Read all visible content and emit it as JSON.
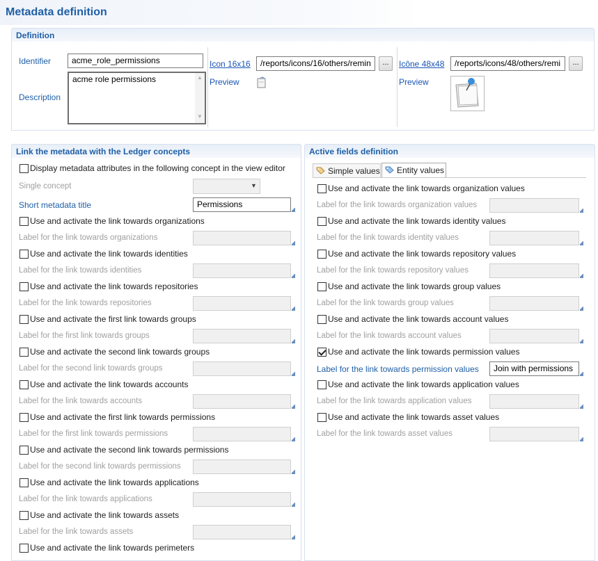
{
  "page": {
    "title": "Metadata definition"
  },
  "definition": {
    "header": "Definition",
    "identifier_label": "Identifier",
    "identifier_value": "acme_role_permissions",
    "description_label": "Description",
    "description_value": "acme role permissions",
    "icon16": {
      "label": "Icon 16x16",
      "path": "/reports/icons/16/others/remin",
      "browse": "...",
      "preview_label": "Preview",
      "preview_icon": "note-icon"
    },
    "icon48": {
      "label": "Icône 48x48",
      "path": "/reports/icons/48/others/remi",
      "browse": "...",
      "preview_label": "Preview",
      "preview_icon": "pinned-note-icon"
    }
  },
  "ledger": {
    "header": "Link the metadata with the Ledger concepts",
    "display_checkbox": "Display metadata attributes in the following concept in the view editor",
    "single_concept_label": "Single concept",
    "short_title_label": "Short metadata title",
    "short_title_value": "Permissions",
    "links": [
      {
        "check": "Use and activate the link towards organizations",
        "label": "Label for the link towards organizations"
      },
      {
        "check": "Use and activate the link towards identities",
        "label": "Label for the link towards identities"
      },
      {
        "check": "Use and activate the link towards repositories",
        "label": "Label for the link towards repositories"
      },
      {
        "check": "Use and activate the first link towards groups",
        "label": "Label for the first link towards groups"
      },
      {
        "check": "Use and activate the second link towards groups",
        "label": "Label for the second link towards groups"
      },
      {
        "check": "Use and activate the link towards accounts",
        "label": "Label for the link towards accounts"
      },
      {
        "check": "Use and activate the first link towards permissions",
        "label": "Label for the first link towards permissions"
      },
      {
        "check": "Use and activate the second link towards permissions",
        "label": "Label for the second link towards permissions"
      },
      {
        "check": "Use and activate the link towards applications",
        "label": "Label for the link towards applications"
      },
      {
        "check": "Use and activate the link towards assets",
        "label": "Label for the link towards assets"
      },
      {
        "check": "Use and activate the link towards perimeters"
      }
    ]
  },
  "active": {
    "header": "Active fields definition",
    "tabs": [
      {
        "label": "Simple values"
      },
      {
        "label": "Entity values"
      }
    ],
    "links": [
      {
        "check": "Use and activate the link towards organization values",
        "label": "Label for the link towards organization values",
        "checked": false
      },
      {
        "check": "Use and activate the link towards identity values",
        "label": "Label for the link towards identity values",
        "checked": false
      },
      {
        "check": "Use and activate the link towards repository values",
        "label": "Label for the link towards repository values",
        "checked": false
      },
      {
        "check": "Use and activate the link towards group values",
        "label": "Label for the link towards group values",
        "checked": false
      },
      {
        "check": "Use and activate the link towards account values",
        "label": "Label for the link towards account values",
        "checked": false
      },
      {
        "check": "Use and activate the link towards permission values",
        "label": "Label for the link towards permission values",
        "checked": true,
        "value": "Join with permissions"
      },
      {
        "check": "Use and activate the link towards application values",
        "label": "Label for the link towards application values",
        "checked": false
      },
      {
        "check": "Use and activate the link towards asset values",
        "label": "Label for the link towards asset values",
        "checked": false
      }
    ]
  },
  "colors": {
    "title": "#1f5fa6",
    "link": "#1a55b5",
    "disabled": "#a0a0a0"
  }
}
